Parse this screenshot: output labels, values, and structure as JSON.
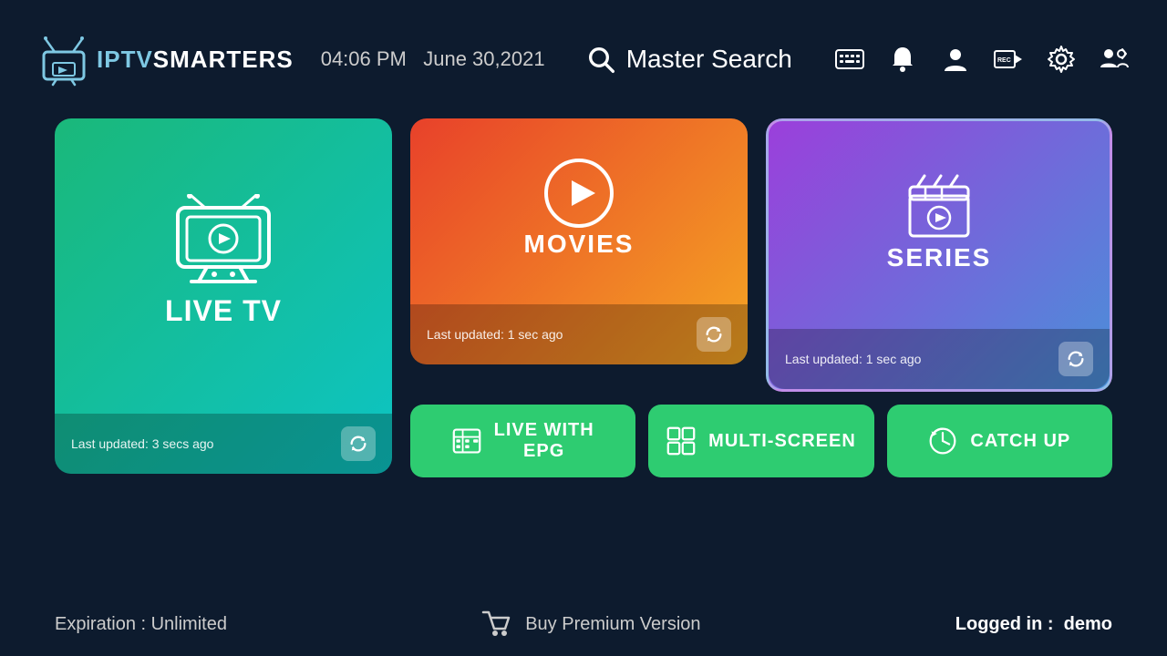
{
  "header": {
    "logo_iptv": "IPTV",
    "logo_smarters": "SMARTERS",
    "time": "04:06 PM",
    "date": "June 30,2021",
    "search_label": "Master Search"
  },
  "icons": {
    "epg_icon": "EPG",
    "bell_icon": "🔔",
    "user_icon": "👤",
    "rec_icon": "REC",
    "settings_icon": "⚙",
    "users_icon": "👥"
  },
  "cards": {
    "live_tv": {
      "title": "LIVE TV",
      "last_updated": "Last updated: 3 secs ago"
    },
    "movies": {
      "title": "MOVIES",
      "last_updated": "Last updated: 1 sec ago"
    },
    "series": {
      "title": "SERIES",
      "last_updated": "Last updated: 1 sec ago"
    }
  },
  "buttons": {
    "live_epg": "LIVE WITH\nEPG",
    "live_epg_line1": "LIVE WITH",
    "live_epg_line2": "EPG",
    "multi_screen": "MULTI-SCREEN",
    "catch_up": "CATCH UP"
  },
  "footer": {
    "expiration": "Expiration : Unlimited",
    "buy_premium": "Buy Premium Version",
    "logged_in_label": "Logged in :",
    "logged_in_user": "demo"
  }
}
